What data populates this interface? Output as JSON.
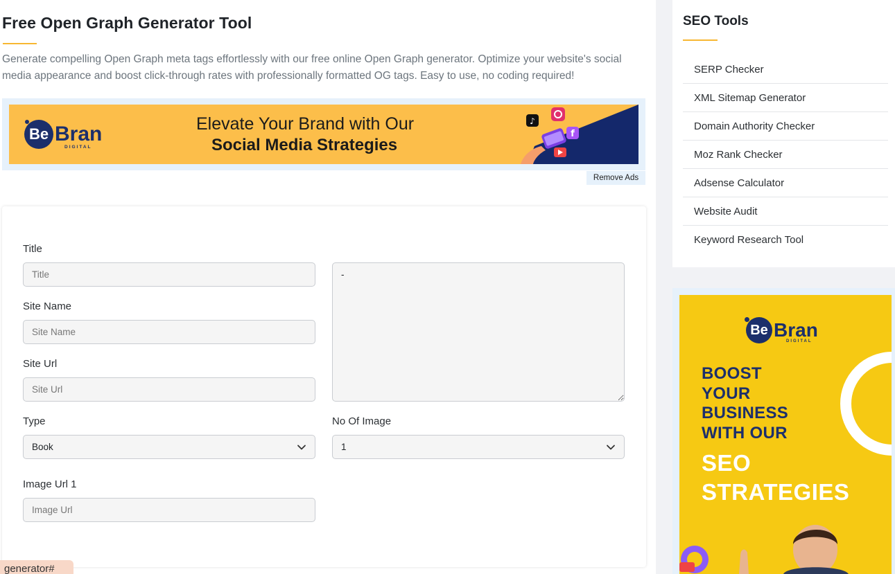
{
  "header": {
    "title": "Free Open Graph Generator Tool",
    "description": "Generate compelling Open Graph meta tags effortlessly with our free online Open Graph generator. Optimize your website's social media appearance and boost click-through rates with professionally formatted OG tags. Easy to use, no coding required!"
  },
  "banner_ad": {
    "logo_be": "Be",
    "logo_bran": "Bran",
    "logo_sub": "DIGITAL",
    "line1": "Elevate Your Brand with Our",
    "line2": "Social Media Strategies",
    "remove_ads": "Remove Ads"
  },
  "form": {
    "title_label": "Title",
    "title_placeholder": "Title",
    "site_name_label": "Site Name",
    "site_name_placeholder": "Site Name",
    "site_url_label": "Site Url",
    "site_url_placeholder": "Site Url",
    "output_value": "-",
    "type_label": "Type",
    "type_value": "Book",
    "no_of_image_label": "No Of Image",
    "no_of_image_value": "1",
    "image_url_label": "Image Url 1",
    "image_url_placeholder": "Image Url"
  },
  "bottom_tag": "generator#",
  "sidebar": {
    "title": "SEO Tools",
    "items": [
      {
        "label": "SERP Checker"
      },
      {
        "label": "XML Sitemap Generator"
      },
      {
        "label": "Domain Authority Checker"
      },
      {
        "label": "Moz Rank Checker"
      },
      {
        "label": "Adsense Calculator"
      },
      {
        "label": "Website Audit"
      },
      {
        "label": "Keyword Research Tool"
      }
    ]
  },
  "side_ad": {
    "logo_be": "Be",
    "logo_bran": "Bran",
    "logo_sub": "DIGITAL",
    "boost_lines": [
      "BOOST",
      "YOUR",
      "BUSINESS",
      "WITH OUR"
    ],
    "seo_lines": [
      "SEO",
      "STRATEGIES"
    ]
  },
  "colors": {
    "accent": "#f7b731",
    "brand_navy": "#1c2f6b",
    "banner_orange": "#fcbe4a",
    "side_ad_yellow": "#f6c913"
  }
}
